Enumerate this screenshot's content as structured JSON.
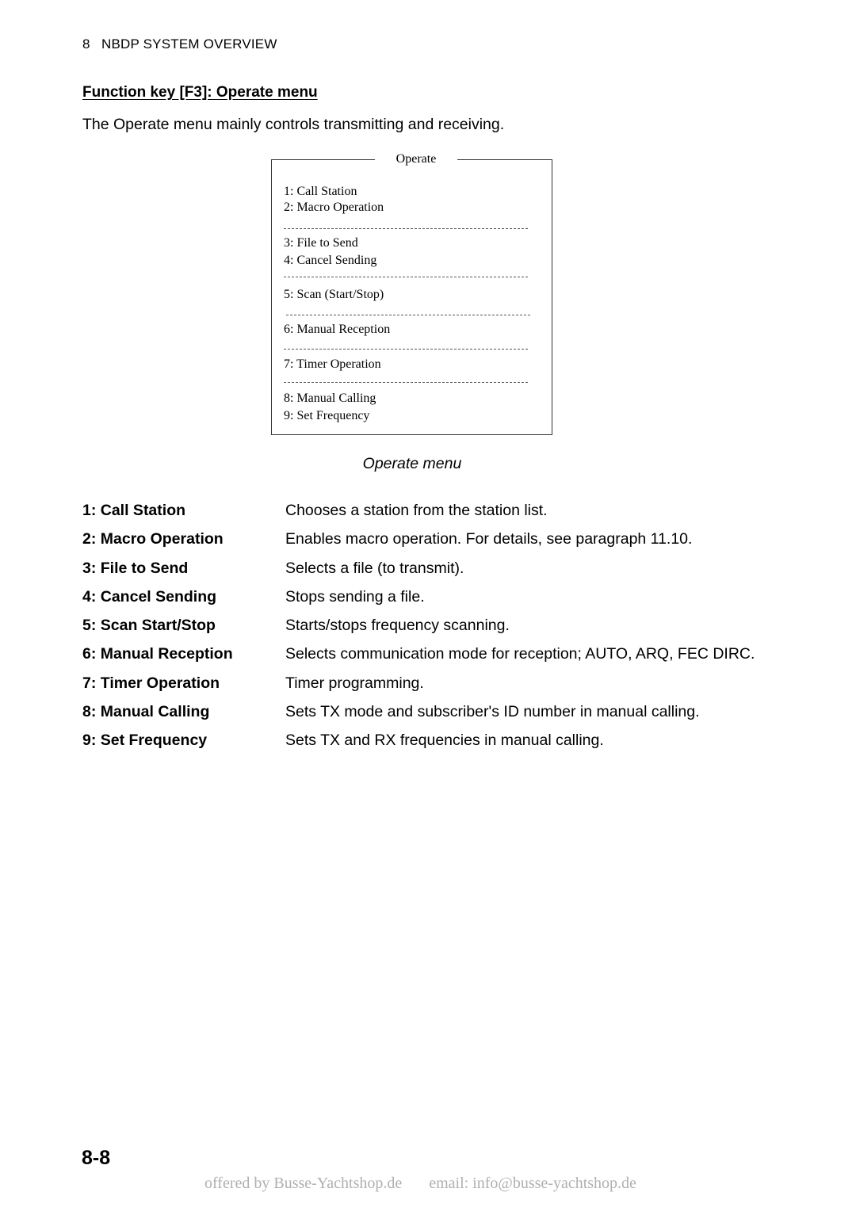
{
  "running_head": {
    "chapter_number": "8",
    "chapter_title": "NBDP SYSTEM OVERVIEW"
  },
  "section": {
    "title": "Function key [F3]: Operate menu",
    "intro": "The Operate menu mainly controls transmitting and receiving."
  },
  "menu_box": {
    "title": "Operate",
    "items": [
      "1: Call Station",
      "2: Macro Operation",
      "3: File to Send",
      "4: Cancel Sending",
      "5: Scan (Start/Stop)",
      "6: Manual Reception",
      "7: Timer Operation",
      "8: Manual Calling",
      "9: Set Frequency"
    ]
  },
  "caption": "Operate menu",
  "descriptions": [
    {
      "term": "1: Call Station",
      "definition": "Chooses a station from the station list."
    },
    {
      "term": "2: Macro Operation",
      "definition": "Enables macro operation. For details, see paragraph 11.10."
    },
    {
      "term": "3: File to Send",
      "definition": "Selects a file (to transmit)."
    },
    {
      "term": "4: Cancel Sending",
      "definition": "Stops sending a file."
    },
    {
      "term": "5: Scan Start/Stop",
      "definition": "Starts/stops frequency scanning."
    },
    {
      "term": "6: Manual Reception",
      "definition": "Selects communication mode for reception; AUTO, ARQ, FEC DIRC."
    },
    {
      "term": "7: Timer Operation",
      "definition": "Timer programming."
    },
    {
      "term": "8: Manual Calling",
      "definition": "Sets TX mode and subscriber's ID number in manual calling."
    },
    {
      "term": "9: Set Frequency",
      "definition": "Sets TX and RX frequencies in manual calling."
    }
  ],
  "page_number": "8-8",
  "footer": {
    "offered_by": "offered by Busse-Yachtshop.de",
    "email": "email: info@busse-yachtshop.de"
  }
}
